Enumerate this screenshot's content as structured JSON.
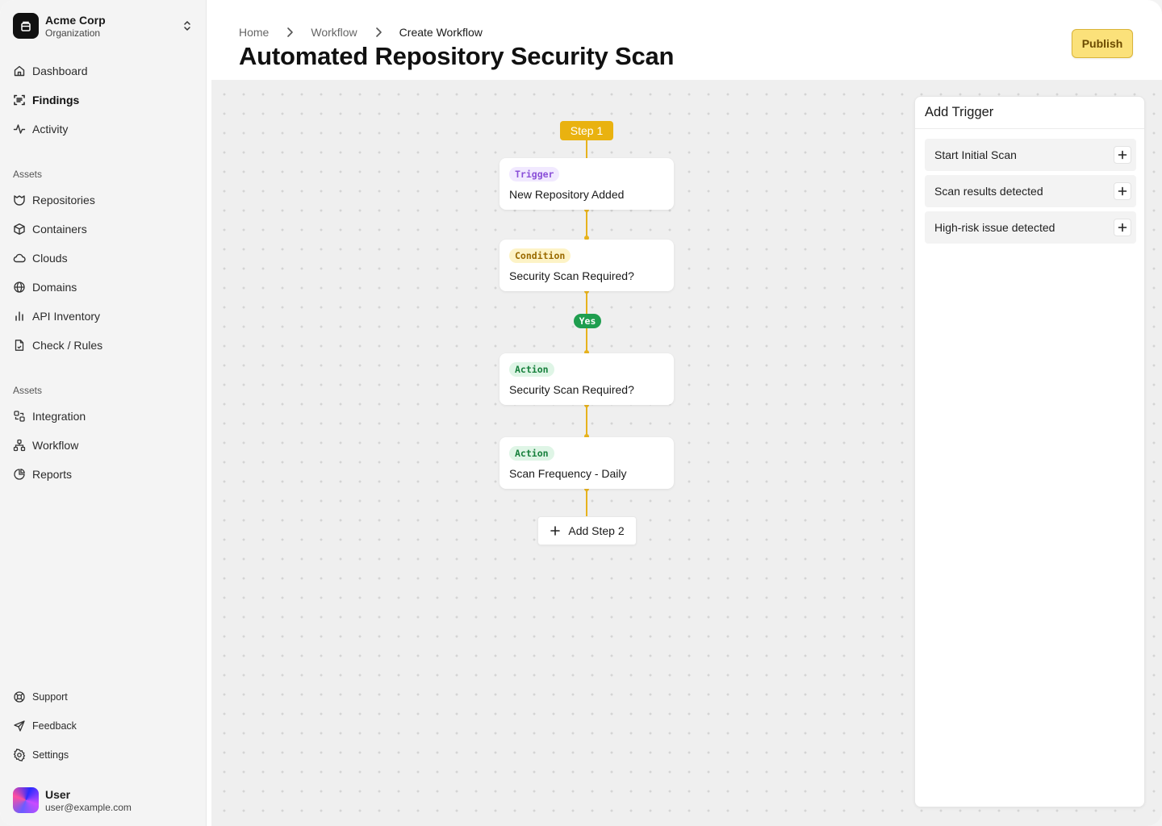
{
  "org": {
    "name": "Acme Corp",
    "subtitle": "Organization"
  },
  "nav": {
    "main": [
      {
        "label": "Dashboard",
        "icon": "home-icon"
      },
      {
        "label": "Findings",
        "icon": "scan-icon",
        "active": true
      },
      {
        "label": "Activity",
        "icon": "activity-icon"
      }
    ],
    "section1_label": "Assets",
    "assets": [
      {
        "label": "Repositories",
        "icon": "repository-icon"
      },
      {
        "label": "Containers",
        "icon": "package-icon"
      },
      {
        "label": "Clouds",
        "icon": "cloud-icon"
      },
      {
        "label": "Domains",
        "icon": "globe-icon"
      },
      {
        "label": "API Inventory",
        "icon": "bar-chart-icon"
      },
      {
        "label": "Check / Rules",
        "icon": "file-check-icon"
      }
    ],
    "section2_label": "Assets",
    "assets2": [
      {
        "label": "Integration",
        "icon": "integration-icon"
      },
      {
        "label": "Workflow",
        "icon": "workflow-icon"
      },
      {
        "label": "Reports",
        "icon": "pie-chart-icon"
      }
    ],
    "footer": [
      {
        "label": "Support",
        "icon": "lifebuoy-icon"
      },
      {
        "label": "Feedback",
        "icon": "send-icon"
      },
      {
        "label": "Settings",
        "icon": "gear-icon"
      }
    ]
  },
  "user": {
    "name": "User",
    "email": "user@example.com"
  },
  "breadcrumb": [
    "Home",
    "Workflow",
    "Create Workflow"
  ],
  "page_title": "Automated Repository Security Scan",
  "publish_label": "Publish",
  "workflow": {
    "step_label": "Step 1",
    "nodes": [
      {
        "tag": "Trigger",
        "title": "New Repository Added"
      },
      {
        "tag": "Condition",
        "title": "Security Scan Required?"
      },
      {
        "tag": "Action",
        "title": "Security Scan Required?"
      },
      {
        "tag": "Action",
        "title": "Scan Frequency - Daily"
      }
    ],
    "branch_label": "Yes",
    "add_step_label": "Add Step 2"
  },
  "panel": {
    "title": "Add Trigger",
    "options": [
      "Start Initial Scan",
      "Scan results detected",
      "High-risk issue detected"
    ]
  },
  "colors": {
    "accent": "#e9b210",
    "publish_bg": "#fbe17a",
    "trigger": "#8a4fd8",
    "condition": "#9a6a00",
    "action": "#17803c",
    "yes": "#1f9e4f"
  }
}
